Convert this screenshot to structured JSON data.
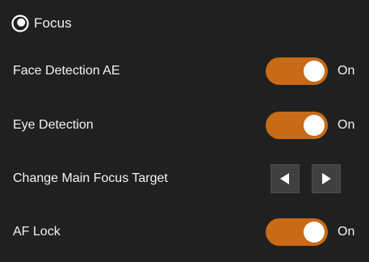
{
  "header": {
    "title": "Focus",
    "icon": "focus-icon"
  },
  "settings": [
    {
      "label": "Face Detection AE",
      "control": "toggle",
      "on": true,
      "state_label": "On"
    },
    {
      "label": "Eye Detection",
      "control": "toggle",
      "on": true,
      "state_label": "On"
    },
    {
      "label": "Change Main Focus Target",
      "control": "stepper",
      "prev_icon": "triangle-left-icon",
      "next_icon": "triangle-right-icon"
    },
    {
      "label": "AF Lock",
      "control": "toggle",
      "on": true,
      "state_label": "On"
    }
  ],
  "colors": {
    "background": "#202020",
    "toggle_on": "#c86a16",
    "knob": "#ffffff",
    "button": "#404040",
    "text": "#f2f2f2"
  }
}
